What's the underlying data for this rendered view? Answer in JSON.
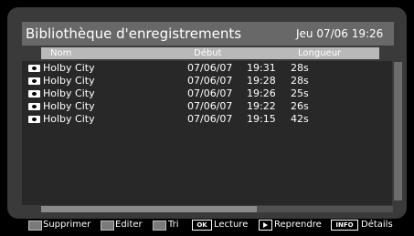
{
  "header": {
    "title": "Bibliothèque d'enregistrements",
    "datetime": "Jeu 07/06 19:26"
  },
  "columns": {
    "name": "Nom",
    "start": "Début",
    "length": "Longueur"
  },
  "recordings": [
    {
      "name": "Holby City",
      "date": "07/06/07",
      "time": "19:31",
      "length": "28s",
      "icon": "recording-icon"
    },
    {
      "name": "Holby City",
      "date": "07/06/07",
      "time": "19:28",
      "length": "28s",
      "icon": "recording-icon"
    },
    {
      "name": "Holby City",
      "date": "07/06/07",
      "time": "19:26",
      "length": "25s",
      "icon": "recording-icon"
    },
    {
      "name": "Holby City",
      "date": "07/06/07",
      "time": "19:22",
      "length": "26s",
      "icon": "recording-icon"
    },
    {
      "name": "Holby City",
      "date": "07/06/07",
      "time": "19:15",
      "length": "42s",
      "icon": "recording-icon"
    }
  ],
  "footer": {
    "delete": "Supprimer",
    "edit": "Editer",
    "sort": "Tri",
    "ok_key": "OK",
    "play": "Lecture",
    "resume": "Reprendre",
    "info_key": "INFO",
    "details": "Détails"
  },
  "colors": {
    "screen_bg": "#3a3a3a",
    "titlebar": "#686868",
    "column_header": "#b9b9b9",
    "list_bg": "#282828"
  }
}
